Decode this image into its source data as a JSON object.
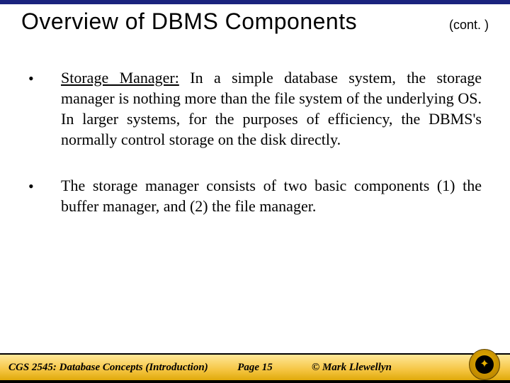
{
  "title": "Overview of DBMS Components",
  "title_suffix": "(cont. )",
  "bullets": [
    {
      "lead": "Storage Manager:",
      "rest": "     In a simple database system, the storage manager is nothing more than the file system of the underlying OS.  In larger systems, for the purposes of efficiency, the DBMS's normally control storage on the disk directly."
    },
    {
      "lead": "",
      "rest": "The storage manager consists of two basic components (1) the buffer manager, and (2) the file manager."
    }
  ],
  "footer": {
    "course": "CGS 2545: Database Concepts  (Introduction)",
    "page": "Page 15",
    "copyright": "© Mark Llewellyn"
  }
}
